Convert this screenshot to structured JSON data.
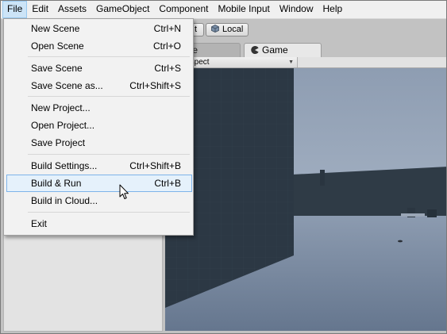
{
  "menubar": {
    "items": [
      "File",
      "Edit",
      "Assets",
      "GameObject",
      "Component",
      "Mobile Input",
      "Window",
      "Help"
    ],
    "active": "File"
  },
  "toolbar": {
    "pivot_label": "t",
    "local_label": "Local"
  },
  "tabs": {
    "scene_label": "ene",
    "game_label": "Game"
  },
  "game_view": {
    "aspect_label": "Aspect"
  },
  "file_menu": {
    "items": [
      {
        "label": "New Scene",
        "shortcut": "Ctrl+N"
      },
      {
        "label": "Open Scene",
        "shortcut": "Ctrl+O"
      },
      {
        "label": "Save Scene",
        "shortcut": "Ctrl+S"
      },
      {
        "label": "Save Scene as...",
        "shortcut": "Ctrl+Shift+S"
      },
      {
        "label": "New Project...",
        "shortcut": ""
      },
      {
        "label": "Open Project...",
        "shortcut": ""
      },
      {
        "label": "Save Project",
        "shortcut": ""
      },
      {
        "label": "Build Settings...",
        "shortcut": "Ctrl+Shift+B"
      },
      {
        "label": "Build & Run",
        "shortcut": "Ctrl+B"
      },
      {
        "label": "Build in Cloud...",
        "shortcut": ""
      },
      {
        "label": "Exit",
        "shortcut": ""
      }
    ],
    "hovered": "Build & Run"
  },
  "colors": {
    "menu_bg": "#f0f0f0",
    "menu_active": "#cce4f7",
    "hover_bg": "#e5f1fb",
    "hover_border": "#7eb4ea",
    "sky": "#a9b7c9",
    "ground": "#7d8ea4",
    "wall": "#2e3a45"
  }
}
